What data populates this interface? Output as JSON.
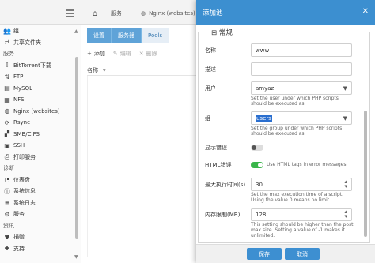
{
  "topbar": {
    "crumb_service": "服务",
    "crumb_nginx": "Nginx (websites)"
  },
  "sidebar": {
    "items": [
      {
        "label": "组",
        "icon": "group-icon",
        "type": "item"
      },
      {
        "label": "共享文件夹",
        "icon": "share-icon",
        "type": "item"
      },
      {
        "label": "服务",
        "icon": "",
        "type": "category"
      },
      {
        "label": "BitTorrent下载",
        "icon": "torrent-icon",
        "type": "item"
      },
      {
        "label": "FTP",
        "icon": "ftp-icon",
        "type": "item"
      },
      {
        "label": "MySQL",
        "icon": "database-icon",
        "type": "item"
      },
      {
        "label": "NFS",
        "icon": "nfs-icon",
        "type": "item"
      },
      {
        "label": "Nginx (websites)",
        "icon": "globe-icon",
        "type": "item"
      },
      {
        "label": "Rsync",
        "icon": "sync-icon",
        "type": "item"
      },
      {
        "label": "SMB/CIFS",
        "icon": "windows-icon",
        "type": "item"
      },
      {
        "label": "SSH",
        "icon": "terminal-icon",
        "type": "item"
      },
      {
        "label": "打印服务",
        "icon": "printer-icon",
        "type": "item"
      },
      {
        "label": "诊断",
        "icon": "",
        "type": "category"
      },
      {
        "label": "仪表盘",
        "icon": "dashboard-icon",
        "type": "item"
      },
      {
        "label": "系统信息",
        "icon": "info-icon",
        "type": "item"
      },
      {
        "label": "系统日志",
        "icon": "log-icon",
        "type": "item"
      },
      {
        "label": "服务",
        "icon": "services-icon",
        "type": "item"
      },
      {
        "label": "资讯",
        "icon": "",
        "type": "category"
      },
      {
        "label": "捐赠",
        "icon": "heart-icon",
        "type": "item"
      },
      {
        "label": "支持",
        "icon": "support-icon",
        "type": "item"
      }
    ]
  },
  "main": {
    "tabs": [
      {
        "label": "设置",
        "active": false
      },
      {
        "label": "服务器",
        "active": false
      },
      {
        "label": "Pools",
        "active": true
      }
    ],
    "toolbar": {
      "add": "添加",
      "edit": "编辑",
      "delete": "删除"
    },
    "table": {
      "column_name": "名称"
    }
  },
  "dialog": {
    "title": "添加池",
    "section": "常规",
    "fields": {
      "name_label": "名称",
      "name_value": "www",
      "desc_label": "描述",
      "desc_value": "",
      "user_label": "用户",
      "user_value": "amyaz",
      "user_hint": "Set the user under which PHP scripts should be executed as.",
      "group_label": "组",
      "group_value": "users",
      "group_hint": "Set the group under which PHP scripts should be executed as.",
      "errors_label": "显示错误",
      "errors_on": false,
      "html_errors_label": "HTML错误",
      "html_errors_on": true,
      "html_errors_hint": "Use HTML tags in error messages.",
      "max_exec_label": "最大执行时间(s)",
      "max_exec_value": "30",
      "max_exec_hint": "Set the max execution time of a script. Using the value 0 means no limit.",
      "mem_label": "内存限制(MB)",
      "mem_value": "128",
      "mem_hint": "This setting should be higher than the post max size. Setting a value of -1 makes it unlimited."
    },
    "buttons": {
      "save": "保存",
      "cancel": "取消"
    }
  }
}
